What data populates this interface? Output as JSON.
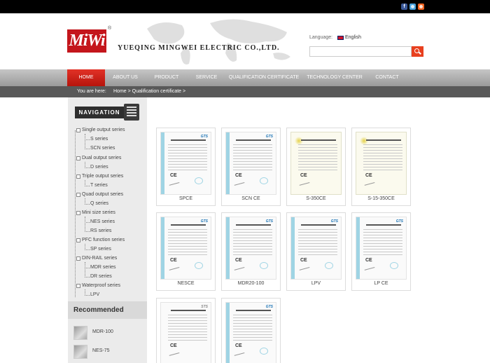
{
  "social": {
    "facebook_glyph": "f",
    "twitter_icon": "twitter-icon",
    "rss_icon": "rss-icon"
  },
  "brand": {
    "logo_text": "MiWi",
    "registered": "®",
    "company": "YUEQING MINGWEI ELECTRIC CO.,LTD."
  },
  "language": {
    "label": "Language:",
    "value": "English"
  },
  "search": {
    "placeholder": ""
  },
  "nav": {
    "items": [
      "HOME",
      "ABOUT US",
      "PRODUCT",
      "SERVICE",
      "QUALIFICATION CERTIFICATE",
      "TECHNOLOGY CENTER",
      "CONTACT"
    ],
    "active": "HOME"
  },
  "breadcrumb": {
    "prefix": "You are here:",
    "path": "Home > Qualification certificate >"
  },
  "sidebar": {
    "heading": "NAVIGATION",
    "categories": [
      {
        "label": "Single output series",
        "subs": [
          "S series",
          "SCN series"
        ]
      },
      {
        "label": "Dual output series",
        "subs": [
          "D series"
        ]
      },
      {
        "label": "Triple output series",
        "subs": [
          "T series"
        ]
      },
      {
        "label": "Quad output series",
        "subs": [
          "Q series"
        ]
      },
      {
        "label": "Mini size series",
        "subs": [
          "NES series",
          "RS series"
        ]
      },
      {
        "label": "PFC function series",
        "subs": [
          "SP series"
        ]
      },
      {
        "label": "DIN-RAIL series",
        "subs": [
          "MDR series",
          "DR series"
        ]
      },
      {
        "label": "Waterproof series",
        "subs": [
          "LPV"
        ]
      }
    ],
    "recommended": {
      "title": "Recommended",
      "items": [
        "MDR-100",
        "NES-75"
      ]
    }
  },
  "certificates": [
    "SPCE",
    "SCN CE",
    "S-350CE",
    "S-15-350CE",
    "NESCE",
    "MDR20-100",
    "LPV",
    "LP CE",
    "",
    ""
  ],
  "cert_marks": {
    "gts": "GTS",
    "sts": "STS",
    "ce": "CE"
  },
  "colors": {
    "accent": "#e23227",
    "nav_bg": "#b0b0b0",
    "breadcrumb_bg": "#595959",
    "sidebar_bg": "#ebebeb"
  }
}
